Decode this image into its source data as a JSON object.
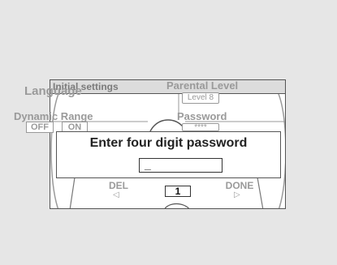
{
  "window": {
    "title": "Initial settings"
  },
  "menu": {
    "language": "Language",
    "parental_level": "Parental Level",
    "parental_level_value": "Level 8",
    "dynamic_range": "Dynamic Range",
    "dynamic_range_off": "OFF",
    "dynamic_range_on": "ON",
    "password": "Password",
    "password_mask": "****"
  },
  "dialog": {
    "title": "Enter four digit password",
    "field_value": "_"
  },
  "controls": {
    "del_label": "DEL",
    "del_arrow": "◁",
    "done_label": "DONE",
    "done_arrow": "▷",
    "digit": "1"
  },
  "icons": {
    "del_arrow": "left-triangle-icon",
    "done_arrow": "right-triangle-icon"
  }
}
